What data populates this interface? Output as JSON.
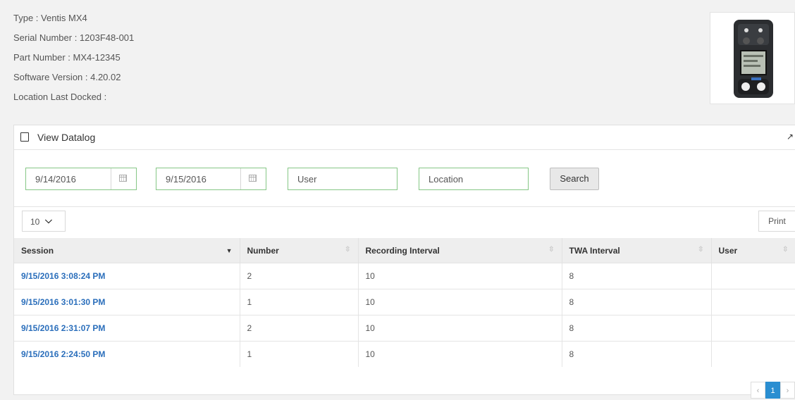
{
  "device": {
    "type_line": "Type : Ventis MX4",
    "serial_line": "Serial Number : 1203F48-001",
    "part_line": "Part Number : MX4-12345",
    "software_line": "Software Version : 4.20.02",
    "location_line": "Location Last Docked :"
  },
  "panel": {
    "title": "View Datalog",
    "icon": "tablet-icon",
    "expand_icon": "expand-icon"
  },
  "filters": {
    "start_date": "9/14/2016",
    "end_date": "9/15/2016",
    "user_placeholder": "User",
    "location_placeholder": "Location",
    "search_label": "Search"
  },
  "page_size": "10",
  "print_label": "Print",
  "table": {
    "columns": [
      "Session",
      "Number",
      "Recording Interval",
      "TWA Interval",
      "User"
    ],
    "rows": [
      {
        "session": "9/15/2016 3:08:24 PM",
        "number": "2",
        "recording": "10",
        "twa": "8",
        "user": ""
      },
      {
        "session": "9/15/2016 3:01:30 PM",
        "number": "1",
        "recording": "10",
        "twa": "8",
        "user": ""
      },
      {
        "session": "9/15/2016 2:31:07 PM",
        "number": "2",
        "recording": "10",
        "twa": "8",
        "user": ""
      },
      {
        "session": "9/15/2016 2:24:50 PM",
        "number": "1",
        "recording": "10",
        "twa": "8",
        "user": ""
      }
    ]
  },
  "pagination": {
    "prev": "‹",
    "current": "1",
    "next": "›"
  },
  "colors": {
    "link": "#2a6ebb",
    "active_page": "#2a8ed1",
    "field_border": "#86c786"
  }
}
